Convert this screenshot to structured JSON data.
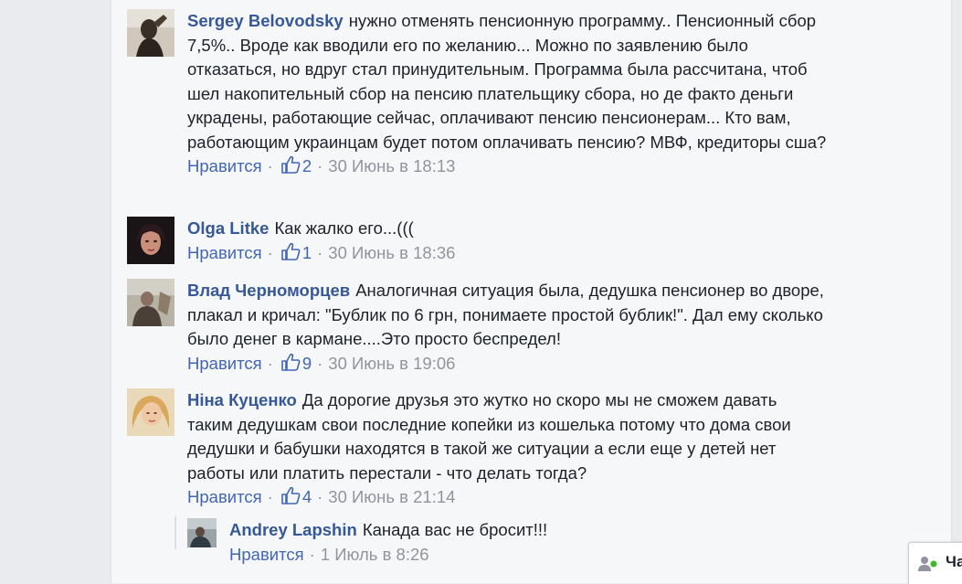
{
  "comments": [
    {
      "author": "Sergey Belovodsky",
      "text": "нужно отменять пенсионную программу.. Пенсионный сбор 7,5%.. Вроде как вводили его по желанию... Можно по заявлению было отказаться, но вдруг стал принудительным. Программа была рассчитана, чтоб шел накопительный сбор на пенсию плательщику сбора, но де факто деньги украдены, работающие сейчас, оплачивают пенсию пенсионерам... Кто вам, работающим украинцам будет потом оплачивать пенсию? МВФ, кредиторы сша?",
      "like_label": "Нравится",
      "likes": "2",
      "timestamp": "30 Июнь в 18:13"
    },
    {
      "author": "Olga Litke",
      "text": "Как жалко его...(((",
      "like_label": "Нравится",
      "likes": "1",
      "timestamp": "30 Июнь в 18:36"
    },
    {
      "author": "Влад Черноморцев",
      "text": "Аналогичная ситуация была, дедушка пенсионер во дворе, плакал и кричал: \"Бублик по 6 грн, понимаете простой бублик!\". Дал ему сколько было денег в кармане....Это просто беспредел!",
      "like_label": "Нравится",
      "likes": "9",
      "timestamp": "30 Июнь в 19:06"
    },
    {
      "author": "Ніна Куценко",
      "text": "Да дорогие друзья это жутко но скоро мы не сможем давать таким дедушкам свои последние копейки из кошелька потому что дома свои дедушки и бабушки находятся в такой же ситуации а если еще у детей нет работы или платить перестали - что делать тогда?",
      "like_label": "Нравится",
      "likes": "4",
      "timestamp": "30 Июнь в 21:14"
    }
  ],
  "reply": {
    "author": "Andrey Lapshin",
    "text": "Канада вас не бросит!!!",
    "like_label": "Нравится",
    "timestamp": "1 Июль в 8:26"
  },
  "chat": {
    "label": "Ча",
    "icon": "chat-people-icon"
  },
  "colors": {
    "link": "#365899",
    "meta": "#90949c",
    "background": "#f6f7f9"
  }
}
